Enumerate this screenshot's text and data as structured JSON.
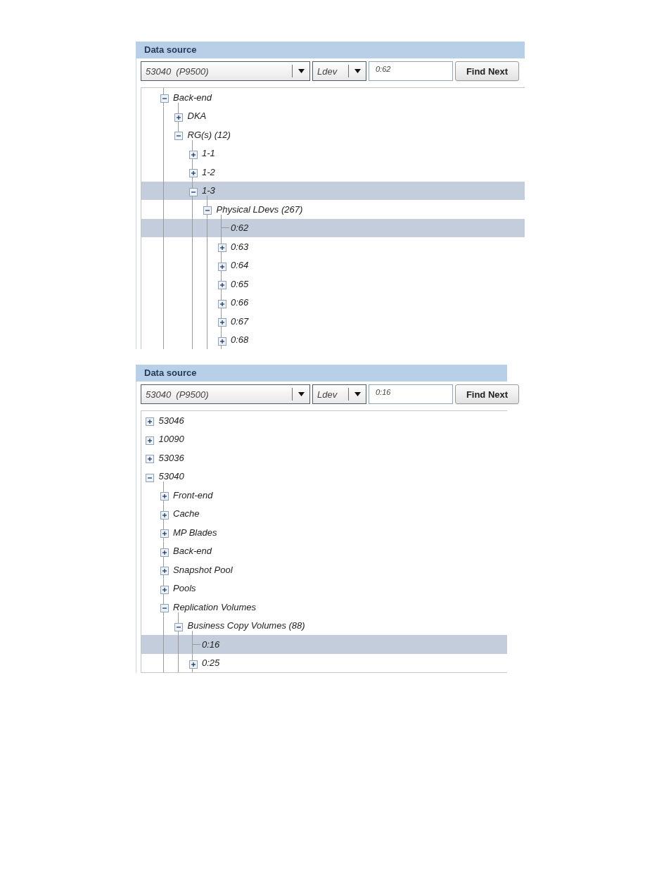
{
  "panels": [
    {
      "title": "Data source",
      "toolbar": {
        "source_dropdown": "53040  (P9500)",
        "type_dropdown": "Ldev",
        "search_field": {
          "value": "0:62"
        },
        "find_button": "Find Next"
      },
      "tree": {
        "scrolled_above": true,
        "children_continue": true,
        "nodes": [
          {
            "label": "Back-end",
            "kind": "branch",
            "expanded": true,
            "selected": false,
            "children_continue": false,
            "children": [
              {
                "label": "DKA",
                "kind": "branch",
                "expanded": false,
                "selected": false
              },
              {
                "label": "RG(s) (12)",
                "kind": "branch",
                "expanded": true,
                "selected": false,
                "children_continue": true,
                "children": [
                  {
                    "label": "1-1",
                    "kind": "branch",
                    "expanded": false,
                    "selected": false
                  },
                  {
                    "label": "1-2",
                    "kind": "branch",
                    "expanded": false,
                    "selected": false
                  },
                  {
                    "label": "1-3",
                    "kind": "branch",
                    "expanded": true,
                    "selected": true,
                    "children_continue": true,
                    "children": [
                      {
                        "label": "Physical LDevs (267)",
                        "kind": "branch",
                        "expanded": true,
                        "selected": false,
                        "children_continue": true,
                        "children": [
                          {
                            "label": "0:62",
                            "kind": "leaf",
                            "selected": true
                          },
                          {
                            "label": "0:63",
                            "kind": "branch",
                            "expanded": false,
                            "selected": false
                          },
                          {
                            "label": "0:64",
                            "kind": "branch",
                            "expanded": false,
                            "selected": false
                          },
                          {
                            "label": "0:65",
                            "kind": "branch",
                            "expanded": false,
                            "selected": false
                          },
                          {
                            "label": "0:66",
                            "kind": "branch",
                            "expanded": false,
                            "selected": false
                          },
                          {
                            "label": "0:67",
                            "kind": "branch",
                            "expanded": false,
                            "selected": false
                          },
                          {
                            "label": "0:68",
                            "kind": "branch",
                            "expanded": false,
                            "selected": false
                          }
                        ]
                      }
                    ]
                  }
                ]
              }
            ]
          }
        ]
      }
    },
    {
      "title": "Data source",
      "toolbar": {
        "source_dropdown": "53040  (P9500)",
        "type_dropdown": "Ldev",
        "search_field": {
          "value": "0:16"
        },
        "find_button": "Find Next"
      },
      "tree": {
        "scrolled_above": false,
        "nodes": [
          {
            "label": "53046",
            "kind": "branch",
            "expanded": false,
            "selected": false
          },
          {
            "label": "10090",
            "kind": "branch",
            "expanded": false,
            "selected": false
          },
          {
            "label": "53036",
            "kind": "branch",
            "expanded": false,
            "selected": false
          },
          {
            "label": "53040",
            "kind": "branch",
            "expanded": true,
            "selected": false,
            "children_continue": true,
            "children": [
              {
                "label": "Front-end",
                "kind": "branch",
                "expanded": false,
                "selected": false
              },
              {
                "label": "Cache",
                "kind": "branch",
                "expanded": false,
                "selected": false
              },
              {
                "label": "MP Blades",
                "kind": "branch",
                "expanded": false,
                "selected": false
              },
              {
                "label": "Back-end",
                "kind": "branch",
                "expanded": false,
                "selected": false
              },
              {
                "label": "Snapshot Pool",
                "kind": "branch",
                "expanded": false,
                "selected": false
              },
              {
                "label": "Pools",
                "kind": "branch",
                "expanded": false,
                "selected": false
              },
              {
                "label": "Replication Volumes",
                "kind": "branch",
                "expanded": true,
                "selected": false,
                "children_continue": true,
                "children": [
                  {
                    "label": "Business Copy Volumes (88)",
                    "kind": "branch",
                    "expanded": true,
                    "selected": false,
                    "children_continue": true,
                    "children": [
                      {
                        "label": "0:16",
                        "kind": "leaf",
                        "selected": true
                      },
                      {
                        "label": "0:25",
                        "kind": "branch",
                        "expanded": false,
                        "selected": false
                      }
                    ]
                  }
                ]
              }
            ]
          }
        ]
      }
    }
  ]
}
